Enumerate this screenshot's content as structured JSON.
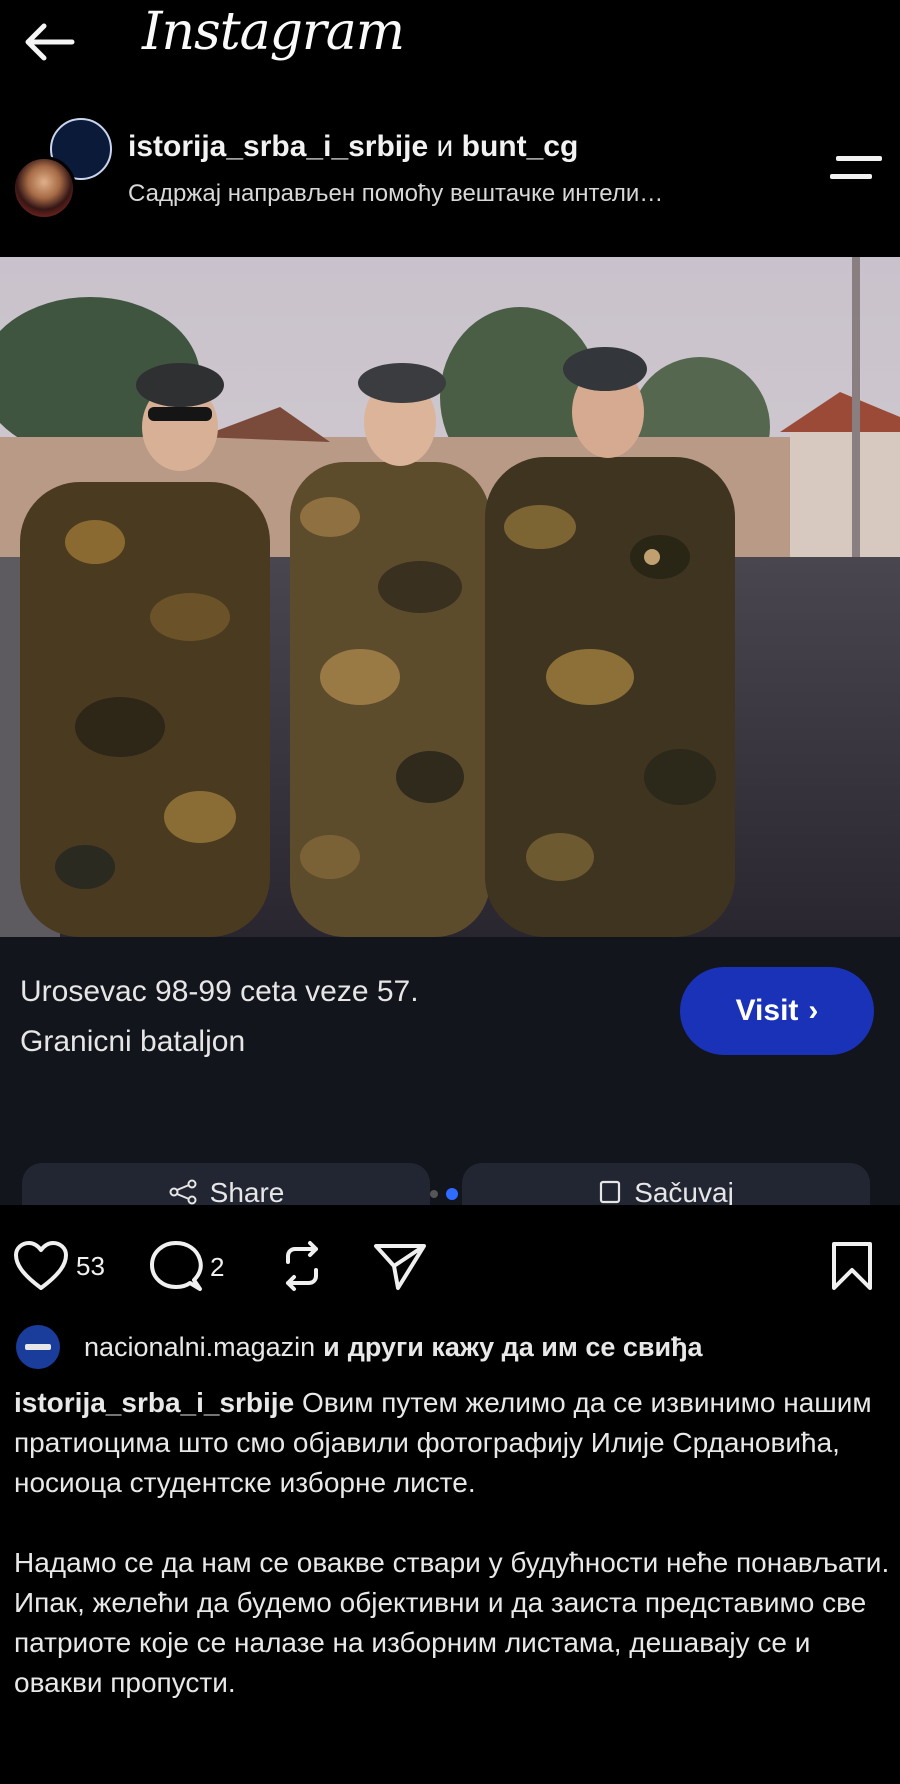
{
  "app": {
    "title": "Instagram"
  },
  "post": {
    "usernames_main": "istorija_srba_i_srbije",
    "usernames_and": "и",
    "usernames_second": "bunt_cg",
    "subline": "Садржај направљен помоћу вештачке интели…"
  },
  "cta": {
    "text_line1": "Urosevac 98-99 ceta veze 57.",
    "text_line2": "Granicni bataljon",
    "visit_label": "Visit",
    "share_label": "Share",
    "save_label": "Sačuvaj"
  },
  "carousel": {
    "count": 2,
    "active_index": 1
  },
  "actions": {
    "like_count": "53",
    "comment_count": "2"
  },
  "likes_line": {
    "username": "nacionalni.magazin",
    "and": "и",
    "rest": "други кажу да им се свиђа"
  },
  "caption": {
    "username": "istorija_srba_i_srbije",
    "paragraph1": "Овим путем желимо да се извинимо нашим пратиоцима што смо објавили фотографију Илије Срдановића, носиоца студентске изборне листе.",
    "paragraph2": "Надамо се да нам се овакве ствари у будућности неће понављати. Ипак, желећи да будемо објективни и да заиста представимо све патриоте које се налазе на изборним листама, дешавају се и овакви пропусти."
  },
  "icons": {
    "back": "arrow-left-icon",
    "menu": "menu-icon",
    "like": "heart-icon",
    "comment": "comment-icon",
    "repost": "repost-icon",
    "send": "send-icon",
    "save": "bookmark-icon",
    "share": "share-icon"
  },
  "colors": {
    "accent": "#1a32b8",
    "dot_active": "#2f6bff"
  }
}
